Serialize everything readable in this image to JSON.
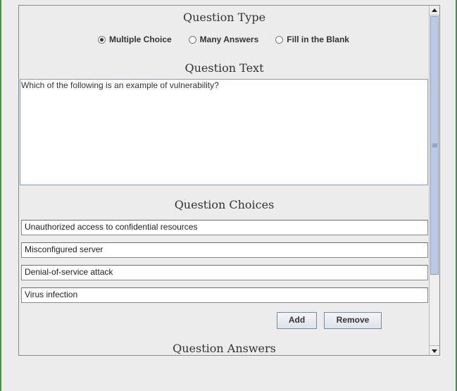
{
  "question_type": {
    "title": "Question Type",
    "options": [
      {
        "label": "Multiple Choice",
        "selected": true
      },
      {
        "label": "Many Answers",
        "selected": false
      },
      {
        "label": "Fill in the Blank",
        "selected": false
      }
    ]
  },
  "question_text": {
    "title": "Question Text",
    "value": "Which of the following is an example of vulnerability?"
  },
  "question_choices": {
    "title": "Question Choices",
    "items": [
      "Unauthorized access to confidential resources",
      "Misconfigured server",
      "Denial-of-service attack",
      "Virus infection"
    ],
    "add_label": "Add",
    "remove_label": "Remove"
  },
  "question_answers": {
    "title": "Question Answers"
  },
  "icons": {
    "scroll_up": "triangle-up-icon",
    "scroll_down": "triangle-down-icon"
  }
}
